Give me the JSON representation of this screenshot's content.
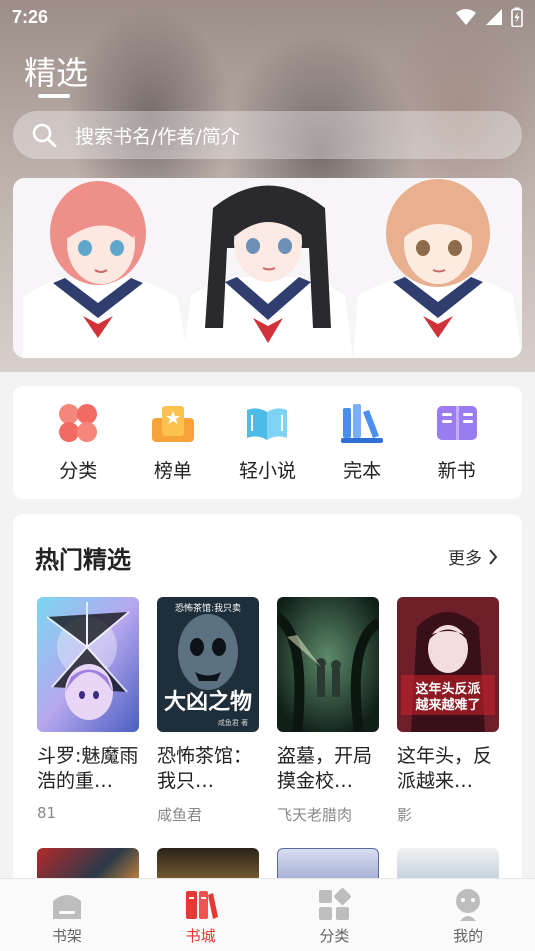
{
  "status": {
    "time": "7:26"
  },
  "header": {
    "title": "精选",
    "search_placeholder": "搜索书名/作者/简介"
  },
  "quick_links": [
    {
      "label": "分类",
      "icon": "category-icon"
    },
    {
      "label": "榜单",
      "icon": "ranking-icon"
    },
    {
      "label": "轻小说",
      "icon": "light-novel-icon"
    },
    {
      "label": "完本",
      "icon": "completed-icon"
    },
    {
      "label": "新书",
      "icon": "new-book-icon"
    }
  ],
  "hot": {
    "title": "热门精选",
    "more_label": "更多",
    "books": [
      {
        "title": "斗罗:魅魔雨浩的重…",
        "author": "81"
      },
      {
        "title": "恐怖茶馆：我只…",
        "author": "咸鱼君",
        "cover_text": "恐怖茶馆:我只卖",
        "cover_big": "大凶之物",
        "cover_author": "咸鱼君 著"
      },
      {
        "title": "盗墓，开局摸金校…",
        "author": "飞天老腊肉"
      },
      {
        "title": "这年头，反派越来…",
        "author": "影",
        "cover_big": "这年头反派越来越难了"
      }
    ]
  },
  "bottom_nav": [
    {
      "label": "书架",
      "icon": "bookshelf-icon",
      "active": false
    },
    {
      "label": "书城",
      "icon": "bookstore-icon",
      "active": true
    },
    {
      "label": "分类",
      "icon": "category-grid-icon",
      "active": false
    },
    {
      "label": "我的",
      "icon": "profile-icon",
      "active": false
    }
  ],
  "colors": {
    "accent": "#e53935",
    "title_text": "#222222",
    "muted_text": "#888888"
  }
}
